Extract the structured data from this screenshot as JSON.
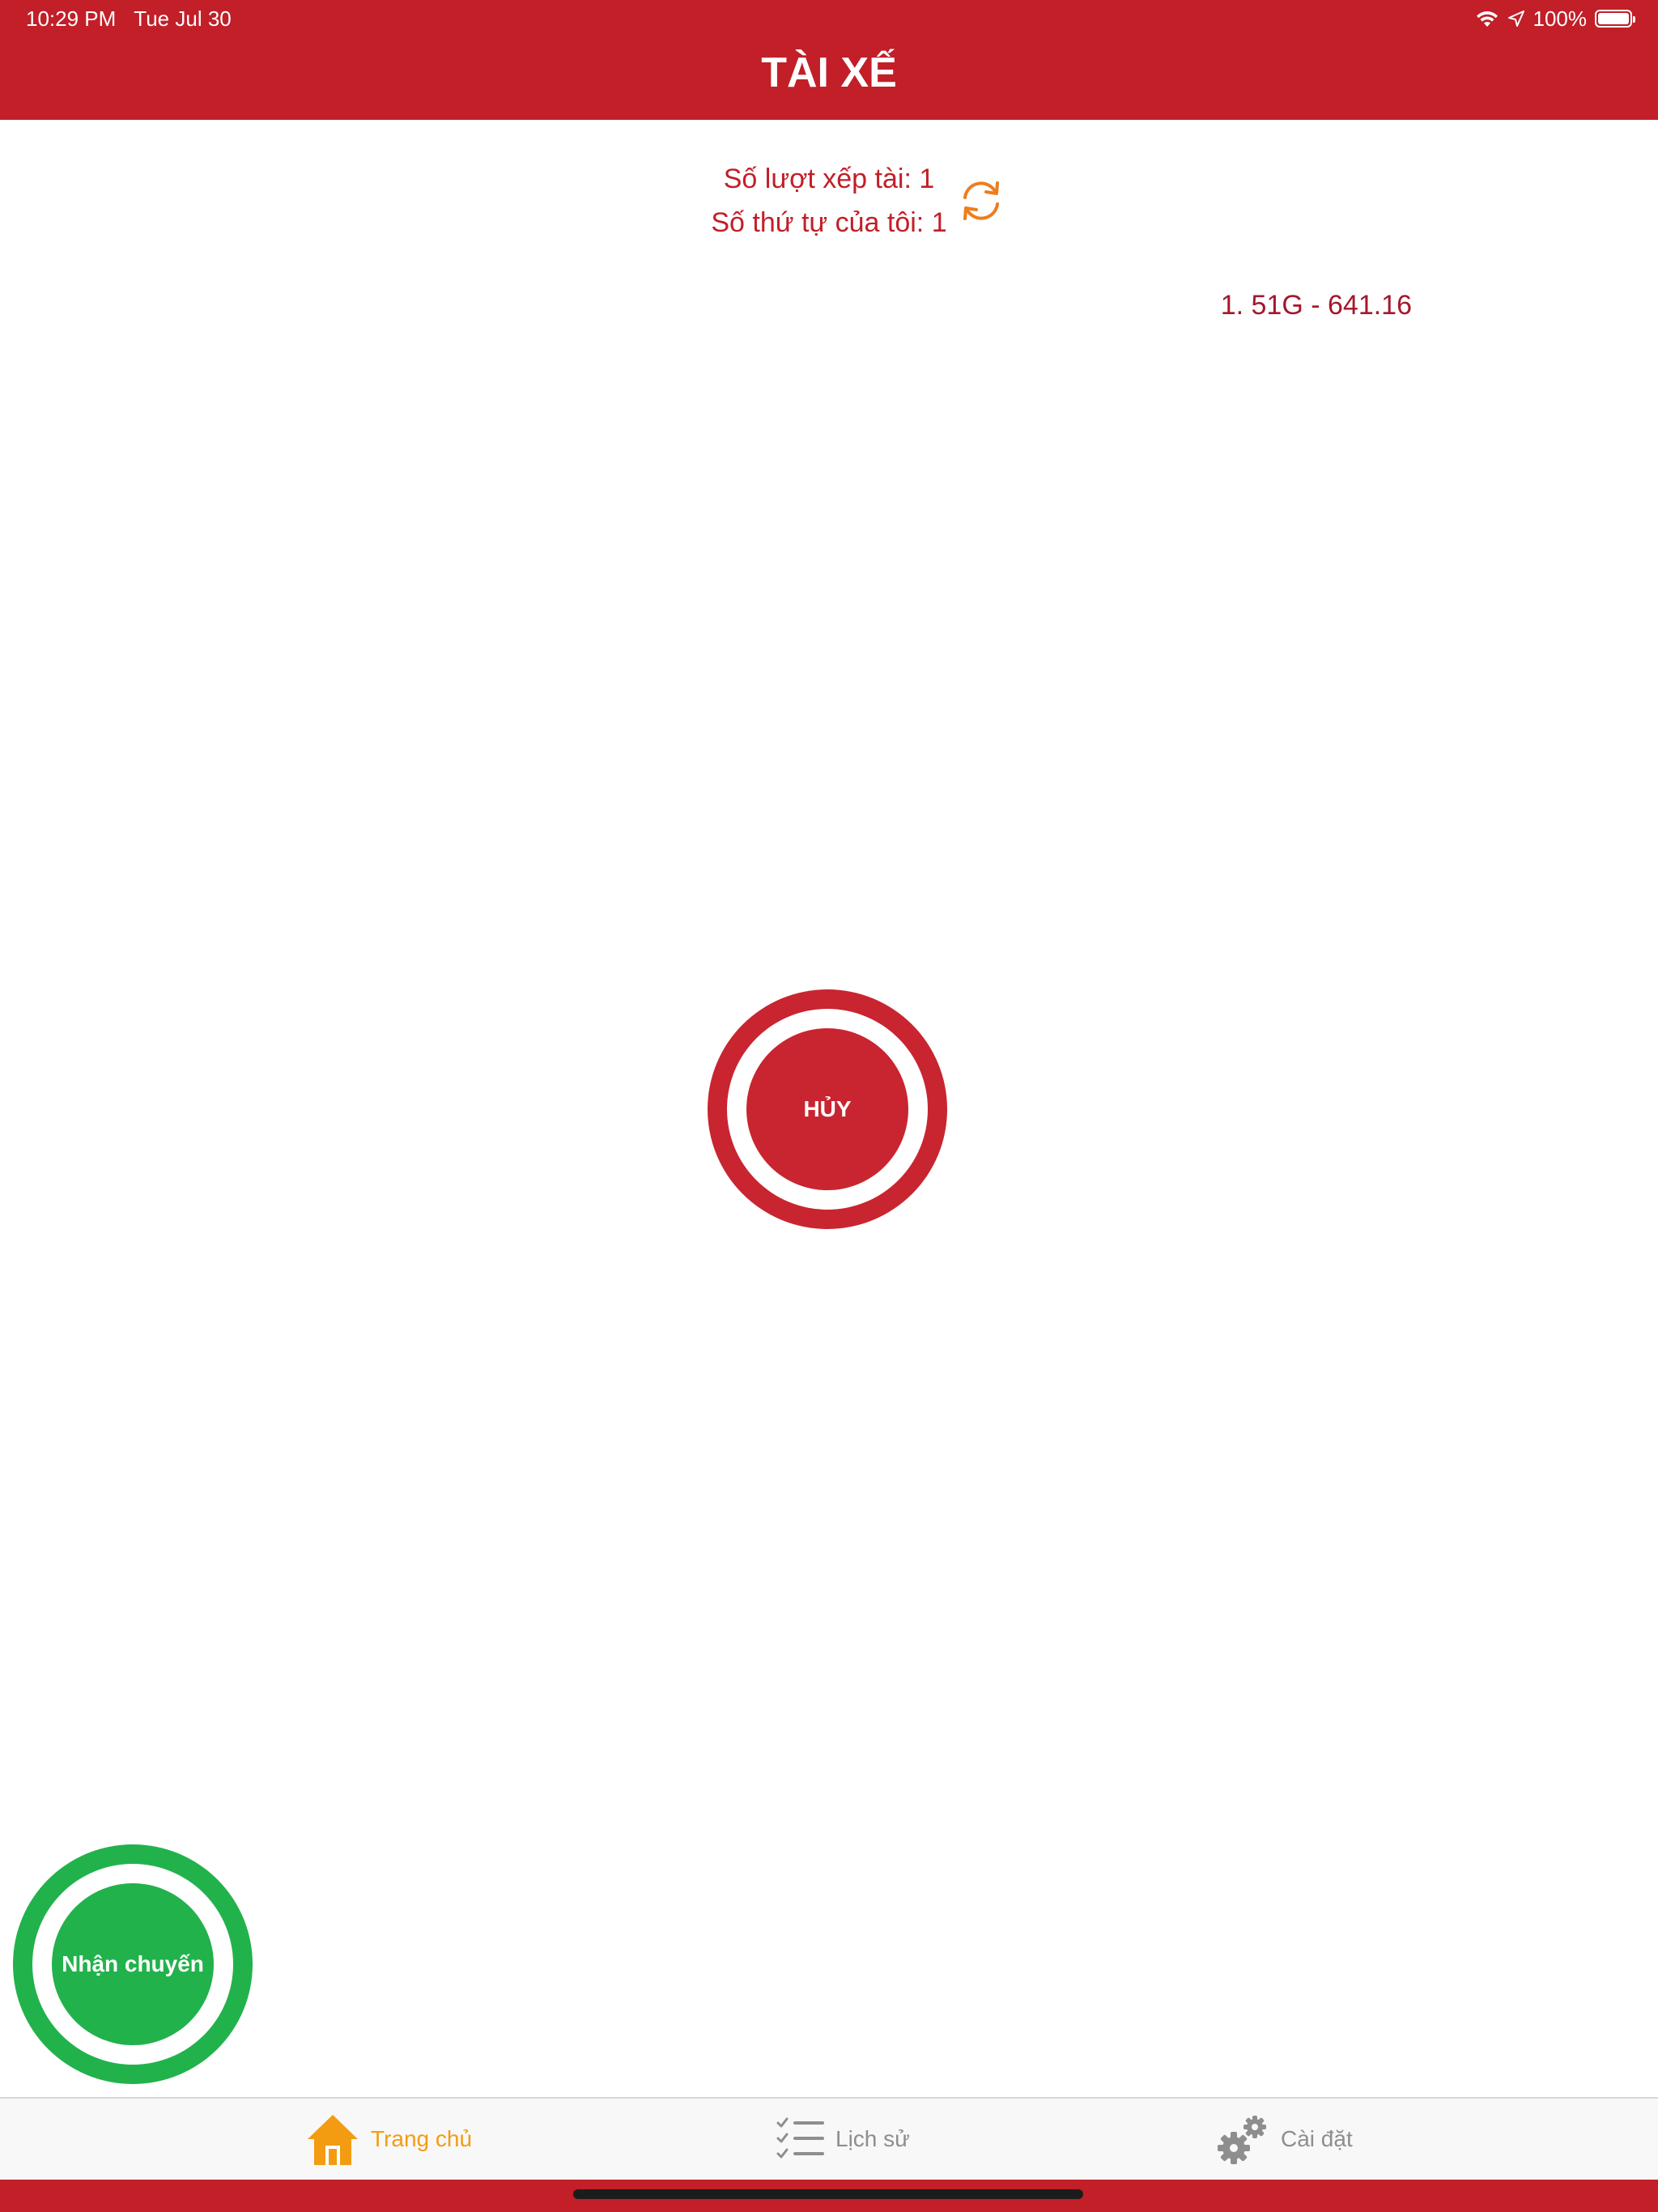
{
  "status_bar": {
    "time": "10:29 PM",
    "date": "Tue Jul 30",
    "battery_text": "100%",
    "battery_level": 1.0
  },
  "header": {
    "title": "TÀI XẾ",
    "color": "#c21f28"
  },
  "queue_info": {
    "turn_count": "Số lượt xếp tài: 1",
    "my_position": "Số thứ tự của tôi: 1",
    "refresh_icon": "refresh-icon"
  },
  "vehicle_list": [
    "1. 51G - 641.16"
  ],
  "cancel_button": {
    "label": "HỦY",
    "color": "#c82530"
  },
  "accept_button": {
    "label": "Nhận chuyến",
    "color": "#22b24c"
  },
  "tabbar": {
    "items": [
      {
        "label": "Trang chủ",
        "icon": "home-icon",
        "active": true
      },
      {
        "label": "Lịch sử",
        "icon": "checklist-icon",
        "active": false
      },
      {
        "label": "Cài đặt",
        "icon": "gears-icon",
        "active": false
      }
    ],
    "active_color": "#f39c12",
    "inactive_color": "#8e8e8e"
  }
}
